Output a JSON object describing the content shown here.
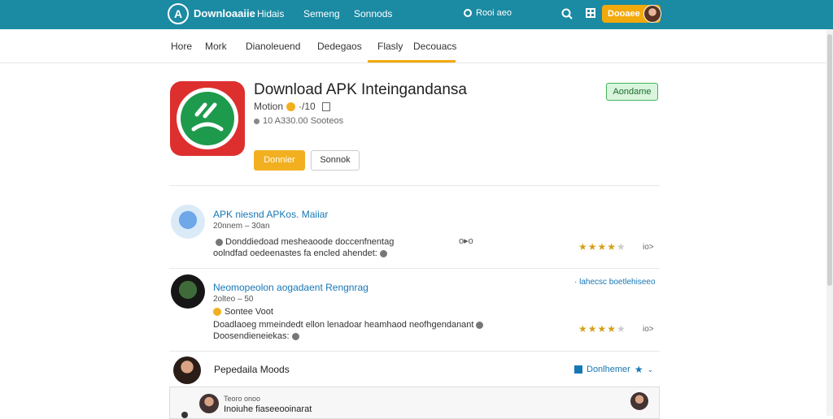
{
  "header": {
    "logo_letter": "A",
    "brand": "Downloaaiie",
    "nav": [
      "Hidais",
      "Semeng",
      "Sonnods"
    ],
    "language": "Rooi aeo",
    "cta_label": "Dooaee"
  },
  "tabs": [
    "Hore",
    "Mork",
    "Dianoleuend",
    "Dedegaos",
    "Flasly",
    "Decouacs"
  ],
  "app": {
    "title": "Download APK Inteingandansa",
    "meta": "Motion",
    "meta_rating": "·/10",
    "downloads": "10 A330.00 Sooteos",
    "badge": "Aondame",
    "primary_button": "Donnier",
    "secondary_button": "Sonnok"
  },
  "reviews": [
    {
      "name": "APK niesnd APKos. Maiiar",
      "sub": "20nnem – 30an",
      "text_line1": "Donddiedoad mesheaoode doccenfnentag",
      "text_line2": "oolndfad oedeenastes fa encled ahendet:",
      "mid_label": "o▸o",
      "rating": 4.5,
      "count": "io>"
    },
    {
      "name": "Neomopeolon aogadaent Rengnrag",
      "sub": "2olteo – 50",
      "extra": "Sontee  Voot",
      "text_line1": "Doadlaoeg mmeindedt ellon lenadoar heamhaod neofhgendanant",
      "text_line2": "Doosendieneiekas:",
      "link": "· lahecsc boetlehiseeo",
      "rating": 4.5,
      "count": "io>"
    }
  ],
  "mods": {
    "title": "Pepedaila Moods",
    "action": "Donlhemer"
  },
  "comment": {
    "time": "Teoro onoo",
    "text": "Inoiuhe fiaseeooinarat"
  },
  "colors": {
    "topbar": "#1b8aa3",
    "accent": "#f2a90c",
    "link": "#1777b5",
    "badge_bg": "#d9f5dd",
    "app_icon": "#de2f2f",
    "app_icon_core": "#1e9a4c"
  }
}
